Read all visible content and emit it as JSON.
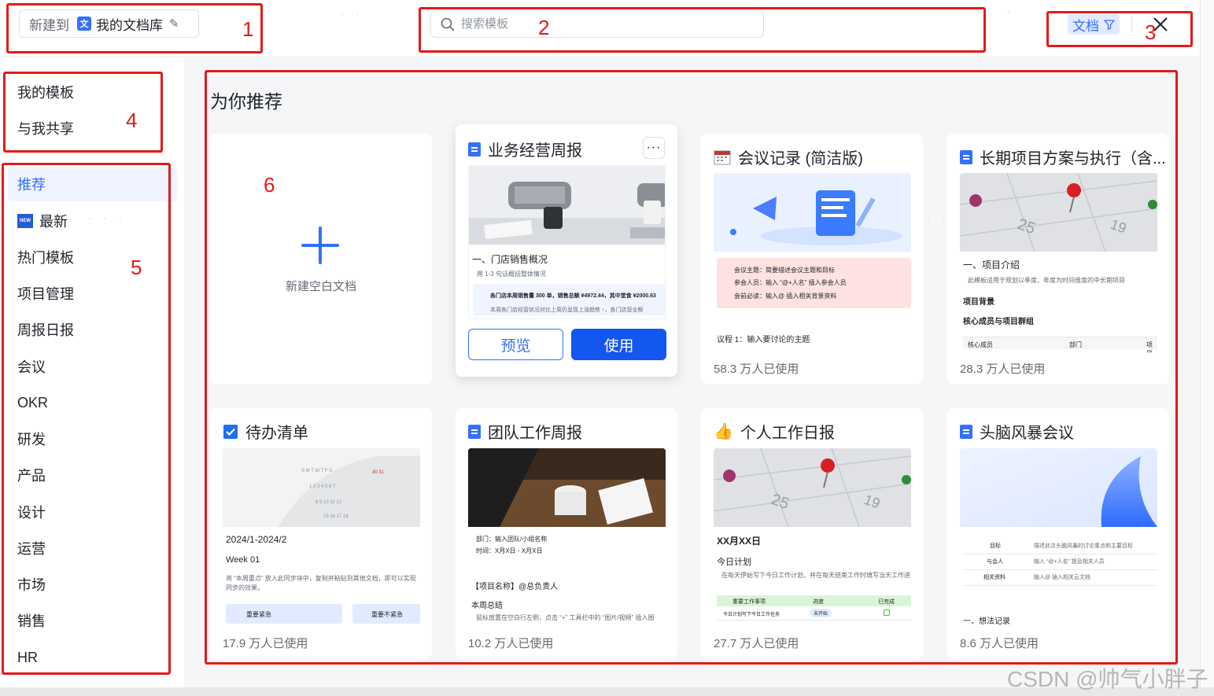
{
  "header": {
    "new_to_label": "新建到",
    "library_name": "我的文档库",
    "search_placeholder": "搜索模板",
    "filter_label": "文档"
  },
  "sidebar": {
    "top_items": [
      "我的模板",
      "与我共享"
    ],
    "categories": [
      "推荐",
      "最新",
      "热门模板",
      "项目管理",
      "周报日报",
      "会议",
      "OKR",
      "研发",
      "产品",
      "设计",
      "运营",
      "市场",
      "销售",
      "HR"
    ],
    "active_category": "推荐"
  },
  "main": {
    "section_title": "为你推荐",
    "blank_card_label": "新建空白文档",
    "preview_label": "预览",
    "use_label": "使用",
    "templates": [
      {
        "title": "业务经营周报",
        "usage": "",
        "thumb_lines": [
          "一、门店销售概况",
          "用 1-3 句话概括整体情况",
          "各门店本周销售量 300 单，销售总额 ¥4972.44，其中堂食 ¥2000.63",
          "本周各门店经营状况对比上周仍呈现上涨趋势 ↑，各门店营业额"
        ]
      },
      {
        "title": "会议记录 (简洁版)",
        "usage": "58.3 万人已使用",
        "thumb_lines": [
          "会议主题：简要描述会议主题和目标",
          "参会人员：输入 “@+人名” 插入参会人员",
          "会前必读：输入@ 插入相关背景资料",
          "议程 1：输入要讨论的主题"
        ]
      },
      {
        "title": "长期项目方案与执行（含...",
        "usage": "28.3 万人已使用",
        "thumb_lines": [
          "一、项目介绍",
          "此模板适用于规划以季度、年度为时间维度的中长期项目",
          "项目背景",
          "核心成员与项目群组",
          "核心成员",
          "部门",
          "项目"
        ]
      },
      {
        "title": "待办清单",
        "usage": "17.9 万人已使用",
        "thumb_lines": [
          "2024/1-2024/2",
          "Week 01",
          "将 “本周重点” 放入此同步块中，复制并粘贴到其他文档，即可以实现同步的效果。",
          "重要紧急",
          "重要不紧急"
        ]
      },
      {
        "title": "团队工作周报",
        "usage": "10.2 万人已使用",
        "thumb_lines": [
          "部门：输入团队/小组名称",
          "时间：X月X日 - X月X日",
          "【项目名称】@总负责人",
          "本周总结",
          "鼠标放置在空白行左侧，点击 “+” 工具栏中的 “图片/视频” 插入图"
        ]
      },
      {
        "title": "个人工作日报",
        "usage": "27.7 万人已使用",
        "thumb_lines": [
          "XX月XX日",
          "今日计划",
          "在每天伊始写下今日工作计划，并在每天结束工作时填写当天工作进",
          "重要工作事项",
          "进度",
          "已完成",
          "今日计划写下今日工作任务",
          "未开始"
        ]
      },
      {
        "title": "头脑风暴会议",
        "usage": "8.6 万人已使用",
        "thumb_lines": [
          "目标",
          "描述此次头脑风暴的讨论重点和主要目标",
          "与会人",
          "输入 “@+人名” 提及相关人员",
          "相关资料",
          "输入@ 插入相关云文档",
          "一、想法记录"
        ]
      }
    ]
  },
  "annotations": [
    "1",
    "2",
    "3",
    "4",
    "5",
    "6"
  ],
  "watermark": "CSDN @帅气小胖子",
  "colors": {
    "accent": "#3370ff",
    "primary_button": "#1456f0",
    "annotation": "#e41a1a"
  }
}
